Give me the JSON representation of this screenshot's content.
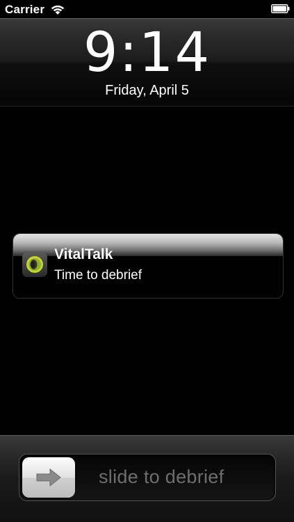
{
  "status_bar": {
    "carrier": "Carrier",
    "icons": [
      "wifi-icon",
      "battery-icon"
    ]
  },
  "lock_screen": {
    "time": "9:14",
    "date": "Friday, April 5"
  },
  "notification": {
    "app_name": "VitalTalk",
    "message": "Time to debrief",
    "icon": "vitaltalk-app-icon",
    "icon_colors": {
      "ring_outer": "#c8d42a",
      "ring_inner": "#6aa23a"
    }
  },
  "unlock_slider": {
    "label": "slide to debrief",
    "knob_icon": "arrow-right-icon"
  }
}
